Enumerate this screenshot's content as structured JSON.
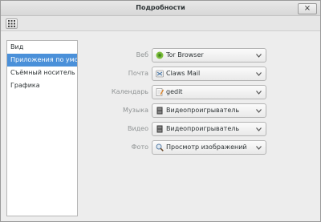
{
  "window": {
    "title": "Подробности",
    "close_glyph": "×"
  },
  "sidebar": {
    "items": [
      {
        "label": "Вид",
        "active": false
      },
      {
        "label": "Приложения по умол...",
        "active": true
      },
      {
        "label": "Съёмный носитель",
        "active": false
      },
      {
        "label": "Графика",
        "active": false
      }
    ]
  },
  "defaults": {
    "rows": [
      {
        "label": "Веб",
        "value": "Tor Browser",
        "icon": "tor-browser-icon"
      },
      {
        "label": "Почта",
        "value": "Claws Mail",
        "icon": "claws-mail-icon"
      },
      {
        "label": "Календарь",
        "value": "gedit",
        "icon": "gedit-icon"
      },
      {
        "label": "Музыка",
        "value": "Видеопроигрыватель",
        "icon": "video-player-icon"
      },
      {
        "label": "Видео",
        "value": "Видеопроигрыватель",
        "icon": "video-player-icon"
      },
      {
        "label": "Фото",
        "value": "Просмотр изображений",
        "icon": "image-viewer-icon"
      }
    ]
  },
  "colors": {
    "selection": "#4a90d9",
    "label": "#8f9394",
    "text": "#2e3436"
  }
}
